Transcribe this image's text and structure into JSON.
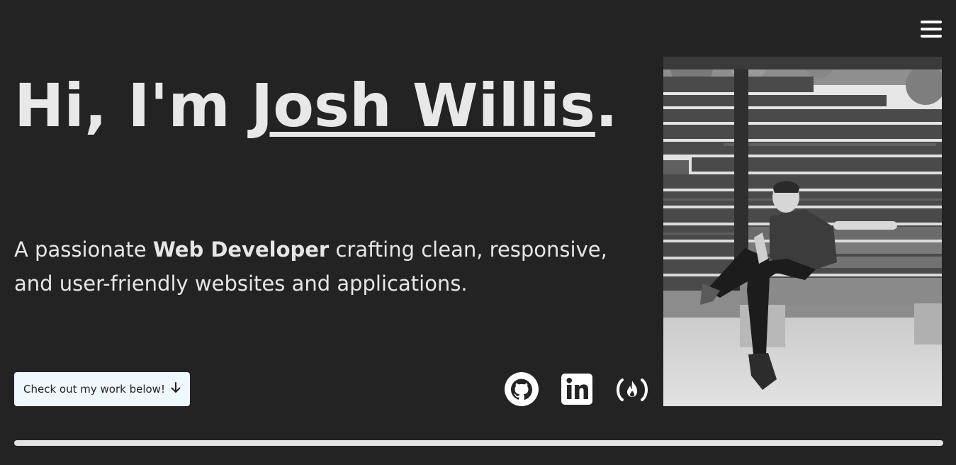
{
  "hero": {
    "greeting": "Hi, I'm ",
    "name": "Josh Willis",
    "period": ".",
    "tagline_before": "A passionate ",
    "tagline_bold": "Web Developer",
    "tagline_after": " crafting clean, responsive, and user-friendly websites and applications.",
    "cta_label": "Check out my work below!",
    "cta_icon": "arrow-down-icon"
  },
  "social": [
    {
      "name": "GitHub",
      "icon": "github-icon"
    },
    {
      "name": "LinkedIn",
      "icon": "linkedin-icon"
    },
    {
      "name": "freeCodeCamp",
      "icon": "freecodecamp-icon"
    }
  ],
  "nav": {
    "menu_icon": "hamburger-menu-icon"
  },
  "colors": {
    "background": "#232323",
    "text": "#e8e8e8",
    "button_bg": "#f0f8ff",
    "divider": "#e2e2e2"
  }
}
